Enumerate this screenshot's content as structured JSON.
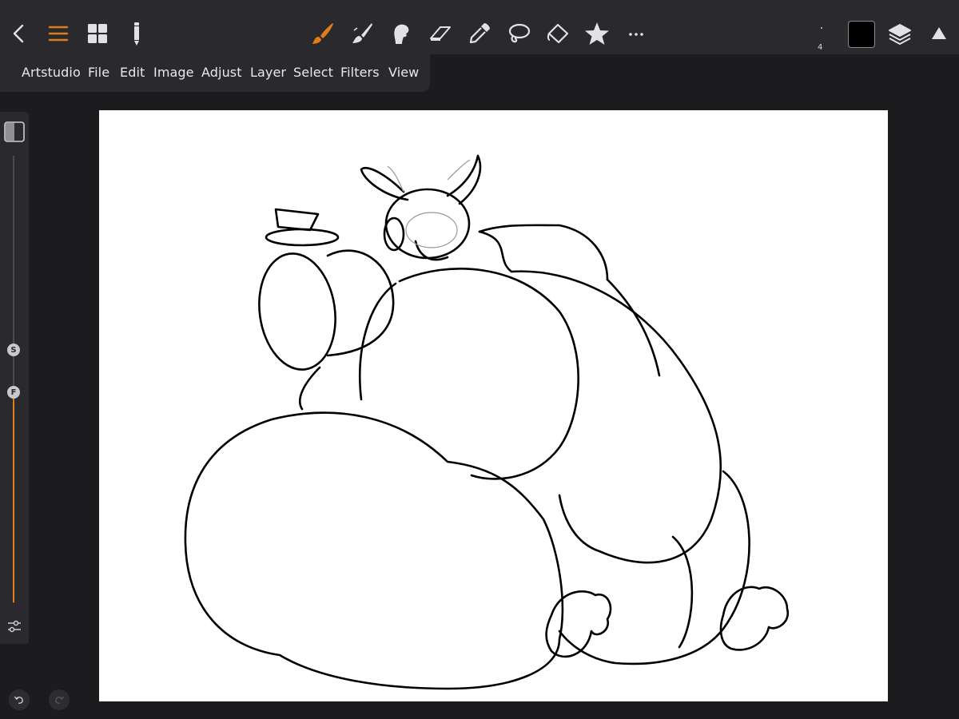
{
  "toolbar": {
    "icons": [
      "back-chevron-icon",
      "menu-icon",
      "gallery-grid-icon",
      "pencil-icon",
      "brush-icon",
      "paint-brush-icon",
      "smudge-icon",
      "eraser-icon",
      "eyedropper-icon",
      "lasso-icon",
      "fill-bucket-icon",
      "star-icon",
      "more-icon",
      "layers-icon",
      "collapse-triangle-icon"
    ],
    "active_tool": "brush-icon",
    "accent_color": "#e07d1a",
    "brush_size": "4",
    "current_color": "#000000"
  },
  "menu": {
    "items": [
      "Artstudio",
      "File",
      "Edit",
      "Image",
      "Adjust",
      "Layer",
      "Select",
      "Filters",
      "View"
    ]
  },
  "sidebar": {
    "size_label": "S",
    "flow_label": "F",
    "size_level": 0.55,
    "flow_level": 0.47
  },
  "history": {
    "undo_icon": "undo-icon",
    "redo_icon": "redo-icon"
  }
}
